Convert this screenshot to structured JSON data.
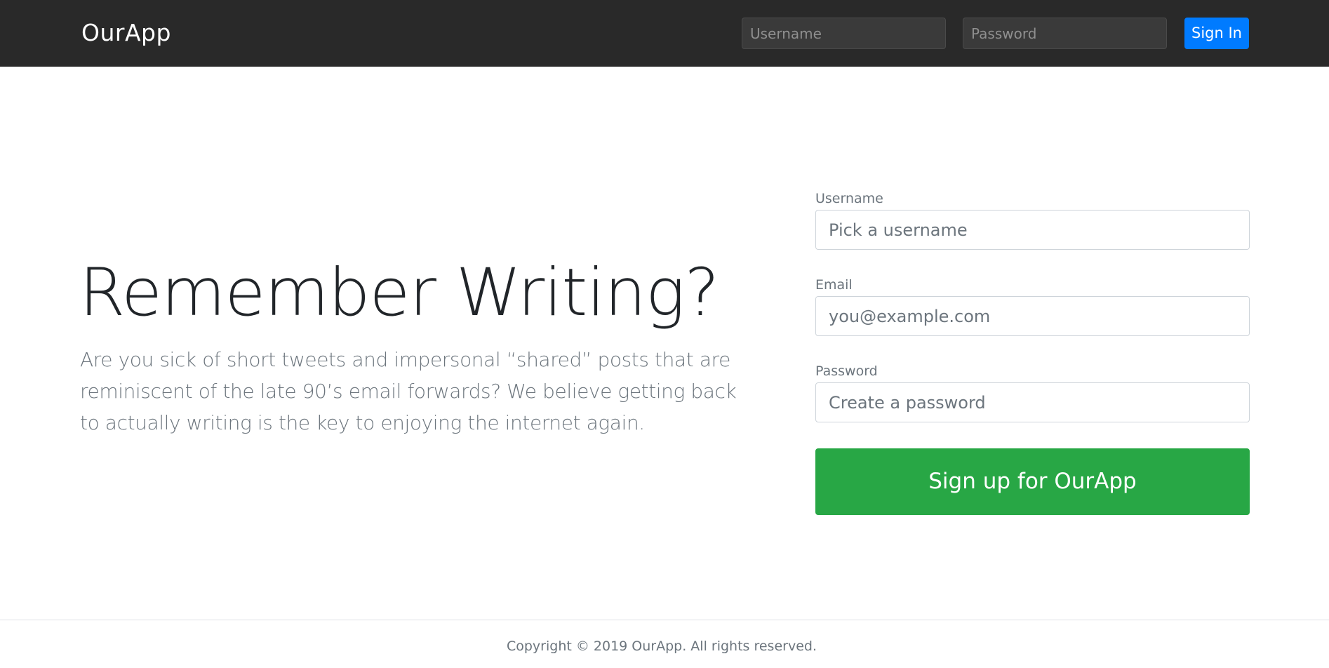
{
  "header": {
    "brand": "OurApp",
    "username_placeholder": "Username",
    "password_placeholder": "Password",
    "signin_label": "Sign In",
    "background_color": "#292929",
    "signin_color": "#007bff"
  },
  "hero": {
    "title": "Remember Writing?",
    "lead": "Are you sick of short tweets and impersonal “shared” posts that are reminiscent of the late 90’s email forwards? We believe getting back to actually writing is the key to enjoying the internet again."
  },
  "signup_form": {
    "username": {
      "label": "Username",
      "placeholder": "Pick a username",
      "value": ""
    },
    "email": {
      "label": "Email",
      "placeholder": "you@example.com",
      "value": ""
    },
    "password": {
      "label": "Password",
      "placeholder": "Create a password",
      "value": ""
    },
    "submit_label": "Sign up for OurApp",
    "submit_color": "#28a745"
  },
  "footer": {
    "copyright": "Copyright © 2019 OurApp. All rights reserved."
  }
}
